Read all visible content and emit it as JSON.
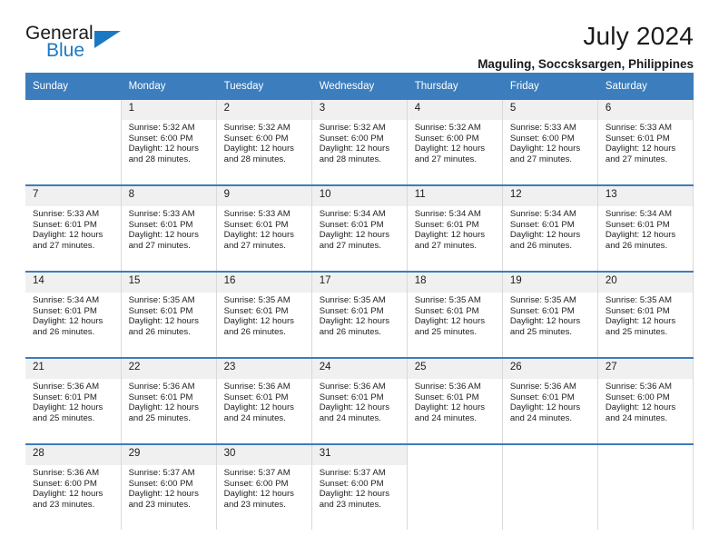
{
  "brand": {
    "name_part1": "General",
    "name_part2": "Blue",
    "triangle_color": "#1b79c4"
  },
  "header": {
    "title": "July 2024",
    "subtitle": "Maguling, Soccsksargen, Philippines"
  },
  "calendar": {
    "header_bg": "#3b7dbd",
    "daynum_bg": "#f0f0f0",
    "weekdays": [
      "Sunday",
      "Monday",
      "Tuesday",
      "Wednesday",
      "Thursday",
      "Friday",
      "Saturday"
    ],
    "weeks": [
      [
        {
          "day": "",
          "sunrise": "",
          "sunset": "",
          "daylight_1": "",
          "daylight_2": ""
        },
        {
          "day": "1",
          "sunrise": "Sunrise: 5:32 AM",
          "sunset": "Sunset: 6:00 PM",
          "daylight_1": "Daylight: 12 hours",
          "daylight_2": "and 28 minutes."
        },
        {
          "day": "2",
          "sunrise": "Sunrise: 5:32 AM",
          "sunset": "Sunset: 6:00 PM",
          "daylight_1": "Daylight: 12 hours",
          "daylight_2": "and 28 minutes."
        },
        {
          "day": "3",
          "sunrise": "Sunrise: 5:32 AM",
          "sunset": "Sunset: 6:00 PM",
          "daylight_1": "Daylight: 12 hours",
          "daylight_2": "and 28 minutes."
        },
        {
          "day": "4",
          "sunrise": "Sunrise: 5:32 AM",
          "sunset": "Sunset: 6:00 PM",
          "daylight_1": "Daylight: 12 hours",
          "daylight_2": "and 27 minutes."
        },
        {
          "day": "5",
          "sunrise": "Sunrise: 5:33 AM",
          "sunset": "Sunset: 6:00 PM",
          "daylight_1": "Daylight: 12 hours",
          "daylight_2": "and 27 minutes."
        },
        {
          "day": "6",
          "sunrise": "Sunrise: 5:33 AM",
          "sunset": "Sunset: 6:01 PM",
          "daylight_1": "Daylight: 12 hours",
          "daylight_2": "and 27 minutes."
        }
      ],
      [
        {
          "day": "7",
          "sunrise": "Sunrise: 5:33 AM",
          "sunset": "Sunset: 6:01 PM",
          "daylight_1": "Daylight: 12 hours",
          "daylight_2": "and 27 minutes."
        },
        {
          "day": "8",
          "sunrise": "Sunrise: 5:33 AM",
          "sunset": "Sunset: 6:01 PM",
          "daylight_1": "Daylight: 12 hours",
          "daylight_2": "and 27 minutes."
        },
        {
          "day": "9",
          "sunrise": "Sunrise: 5:33 AM",
          "sunset": "Sunset: 6:01 PM",
          "daylight_1": "Daylight: 12 hours",
          "daylight_2": "and 27 minutes."
        },
        {
          "day": "10",
          "sunrise": "Sunrise: 5:34 AM",
          "sunset": "Sunset: 6:01 PM",
          "daylight_1": "Daylight: 12 hours",
          "daylight_2": "and 27 minutes."
        },
        {
          "day": "11",
          "sunrise": "Sunrise: 5:34 AM",
          "sunset": "Sunset: 6:01 PM",
          "daylight_1": "Daylight: 12 hours",
          "daylight_2": "and 27 minutes."
        },
        {
          "day": "12",
          "sunrise": "Sunrise: 5:34 AM",
          "sunset": "Sunset: 6:01 PM",
          "daylight_1": "Daylight: 12 hours",
          "daylight_2": "and 26 minutes."
        },
        {
          "day": "13",
          "sunrise": "Sunrise: 5:34 AM",
          "sunset": "Sunset: 6:01 PM",
          "daylight_1": "Daylight: 12 hours",
          "daylight_2": "and 26 minutes."
        }
      ],
      [
        {
          "day": "14",
          "sunrise": "Sunrise: 5:34 AM",
          "sunset": "Sunset: 6:01 PM",
          "daylight_1": "Daylight: 12 hours",
          "daylight_2": "and 26 minutes."
        },
        {
          "day": "15",
          "sunrise": "Sunrise: 5:35 AM",
          "sunset": "Sunset: 6:01 PM",
          "daylight_1": "Daylight: 12 hours",
          "daylight_2": "and 26 minutes."
        },
        {
          "day": "16",
          "sunrise": "Sunrise: 5:35 AM",
          "sunset": "Sunset: 6:01 PM",
          "daylight_1": "Daylight: 12 hours",
          "daylight_2": "and 26 minutes."
        },
        {
          "day": "17",
          "sunrise": "Sunrise: 5:35 AM",
          "sunset": "Sunset: 6:01 PM",
          "daylight_1": "Daylight: 12 hours",
          "daylight_2": "and 26 minutes."
        },
        {
          "day": "18",
          "sunrise": "Sunrise: 5:35 AM",
          "sunset": "Sunset: 6:01 PM",
          "daylight_1": "Daylight: 12 hours",
          "daylight_2": "and 25 minutes."
        },
        {
          "day": "19",
          "sunrise": "Sunrise: 5:35 AM",
          "sunset": "Sunset: 6:01 PM",
          "daylight_1": "Daylight: 12 hours",
          "daylight_2": "and 25 minutes."
        },
        {
          "day": "20",
          "sunrise": "Sunrise: 5:35 AM",
          "sunset": "Sunset: 6:01 PM",
          "daylight_1": "Daylight: 12 hours",
          "daylight_2": "and 25 minutes."
        }
      ],
      [
        {
          "day": "21",
          "sunrise": "Sunrise: 5:36 AM",
          "sunset": "Sunset: 6:01 PM",
          "daylight_1": "Daylight: 12 hours",
          "daylight_2": "and 25 minutes."
        },
        {
          "day": "22",
          "sunrise": "Sunrise: 5:36 AM",
          "sunset": "Sunset: 6:01 PM",
          "daylight_1": "Daylight: 12 hours",
          "daylight_2": "and 25 minutes."
        },
        {
          "day": "23",
          "sunrise": "Sunrise: 5:36 AM",
          "sunset": "Sunset: 6:01 PM",
          "daylight_1": "Daylight: 12 hours",
          "daylight_2": "and 24 minutes."
        },
        {
          "day": "24",
          "sunrise": "Sunrise: 5:36 AM",
          "sunset": "Sunset: 6:01 PM",
          "daylight_1": "Daylight: 12 hours",
          "daylight_2": "and 24 minutes."
        },
        {
          "day": "25",
          "sunrise": "Sunrise: 5:36 AM",
          "sunset": "Sunset: 6:01 PM",
          "daylight_1": "Daylight: 12 hours",
          "daylight_2": "and 24 minutes."
        },
        {
          "day": "26",
          "sunrise": "Sunrise: 5:36 AM",
          "sunset": "Sunset: 6:01 PM",
          "daylight_1": "Daylight: 12 hours",
          "daylight_2": "and 24 minutes."
        },
        {
          "day": "27",
          "sunrise": "Sunrise: 5:36 AM",
          "sunset": "Sunset: 6:00 PM",
          "daylight_1": "Daylight: 12 hours",
          "daylight_2": "and 24 minutes."
        }
      ],
      [
        {
          "day": "28",
          "sunrise": "Sunrise: 5:36 AM",
          "sunset": "Sunset: 6:00 PM",
          "daylight_1": "Daylight: 12 hours",
          "daylight_2": "and 23 minutes."
        },
        {
          "day": "29",
          "sunrise": "Sunrise: 5:37 AM",
          "sunset": "Sunset: 6:00 PM",
          "daylight_1": "Daylight: 12 hours",
          "daylight_2": "and 23 minutes."
        },
        {
          "day": "30",
          "sunrise": "Sunrise: 5:37 AM",
          "sunset": "Sunset: 6:00 PM",
          "daylight_1": "Daylight: 12 hours",
          "daylight_2": "and 23 minutes."
        },
        {
          "day": "31",
          "sunrise": "Sunrise: 5:37 AM",
          "sunset": "Sunset: 6:00 PM",
          "daylight_1": "Daylight: 12 hours",
          "daylight_2": "and 23 minutes."
        },
        {
          "day": "",
          "sunrise": "",
          "sunset": "",
          "daylight_1": "",
          "daylight_2": ""
        },
        {
          "day": "",
          "sunrise": "",
          "sunset": "",
          "daylight_1": "",
          "daylight_2": ""
        },
        {
          "day": "",
          "sunrise": "",
          "sunset": "",
          "daylight_1": "",
          "daylight_2": ""
        }
      ]
    ]
  }
}
